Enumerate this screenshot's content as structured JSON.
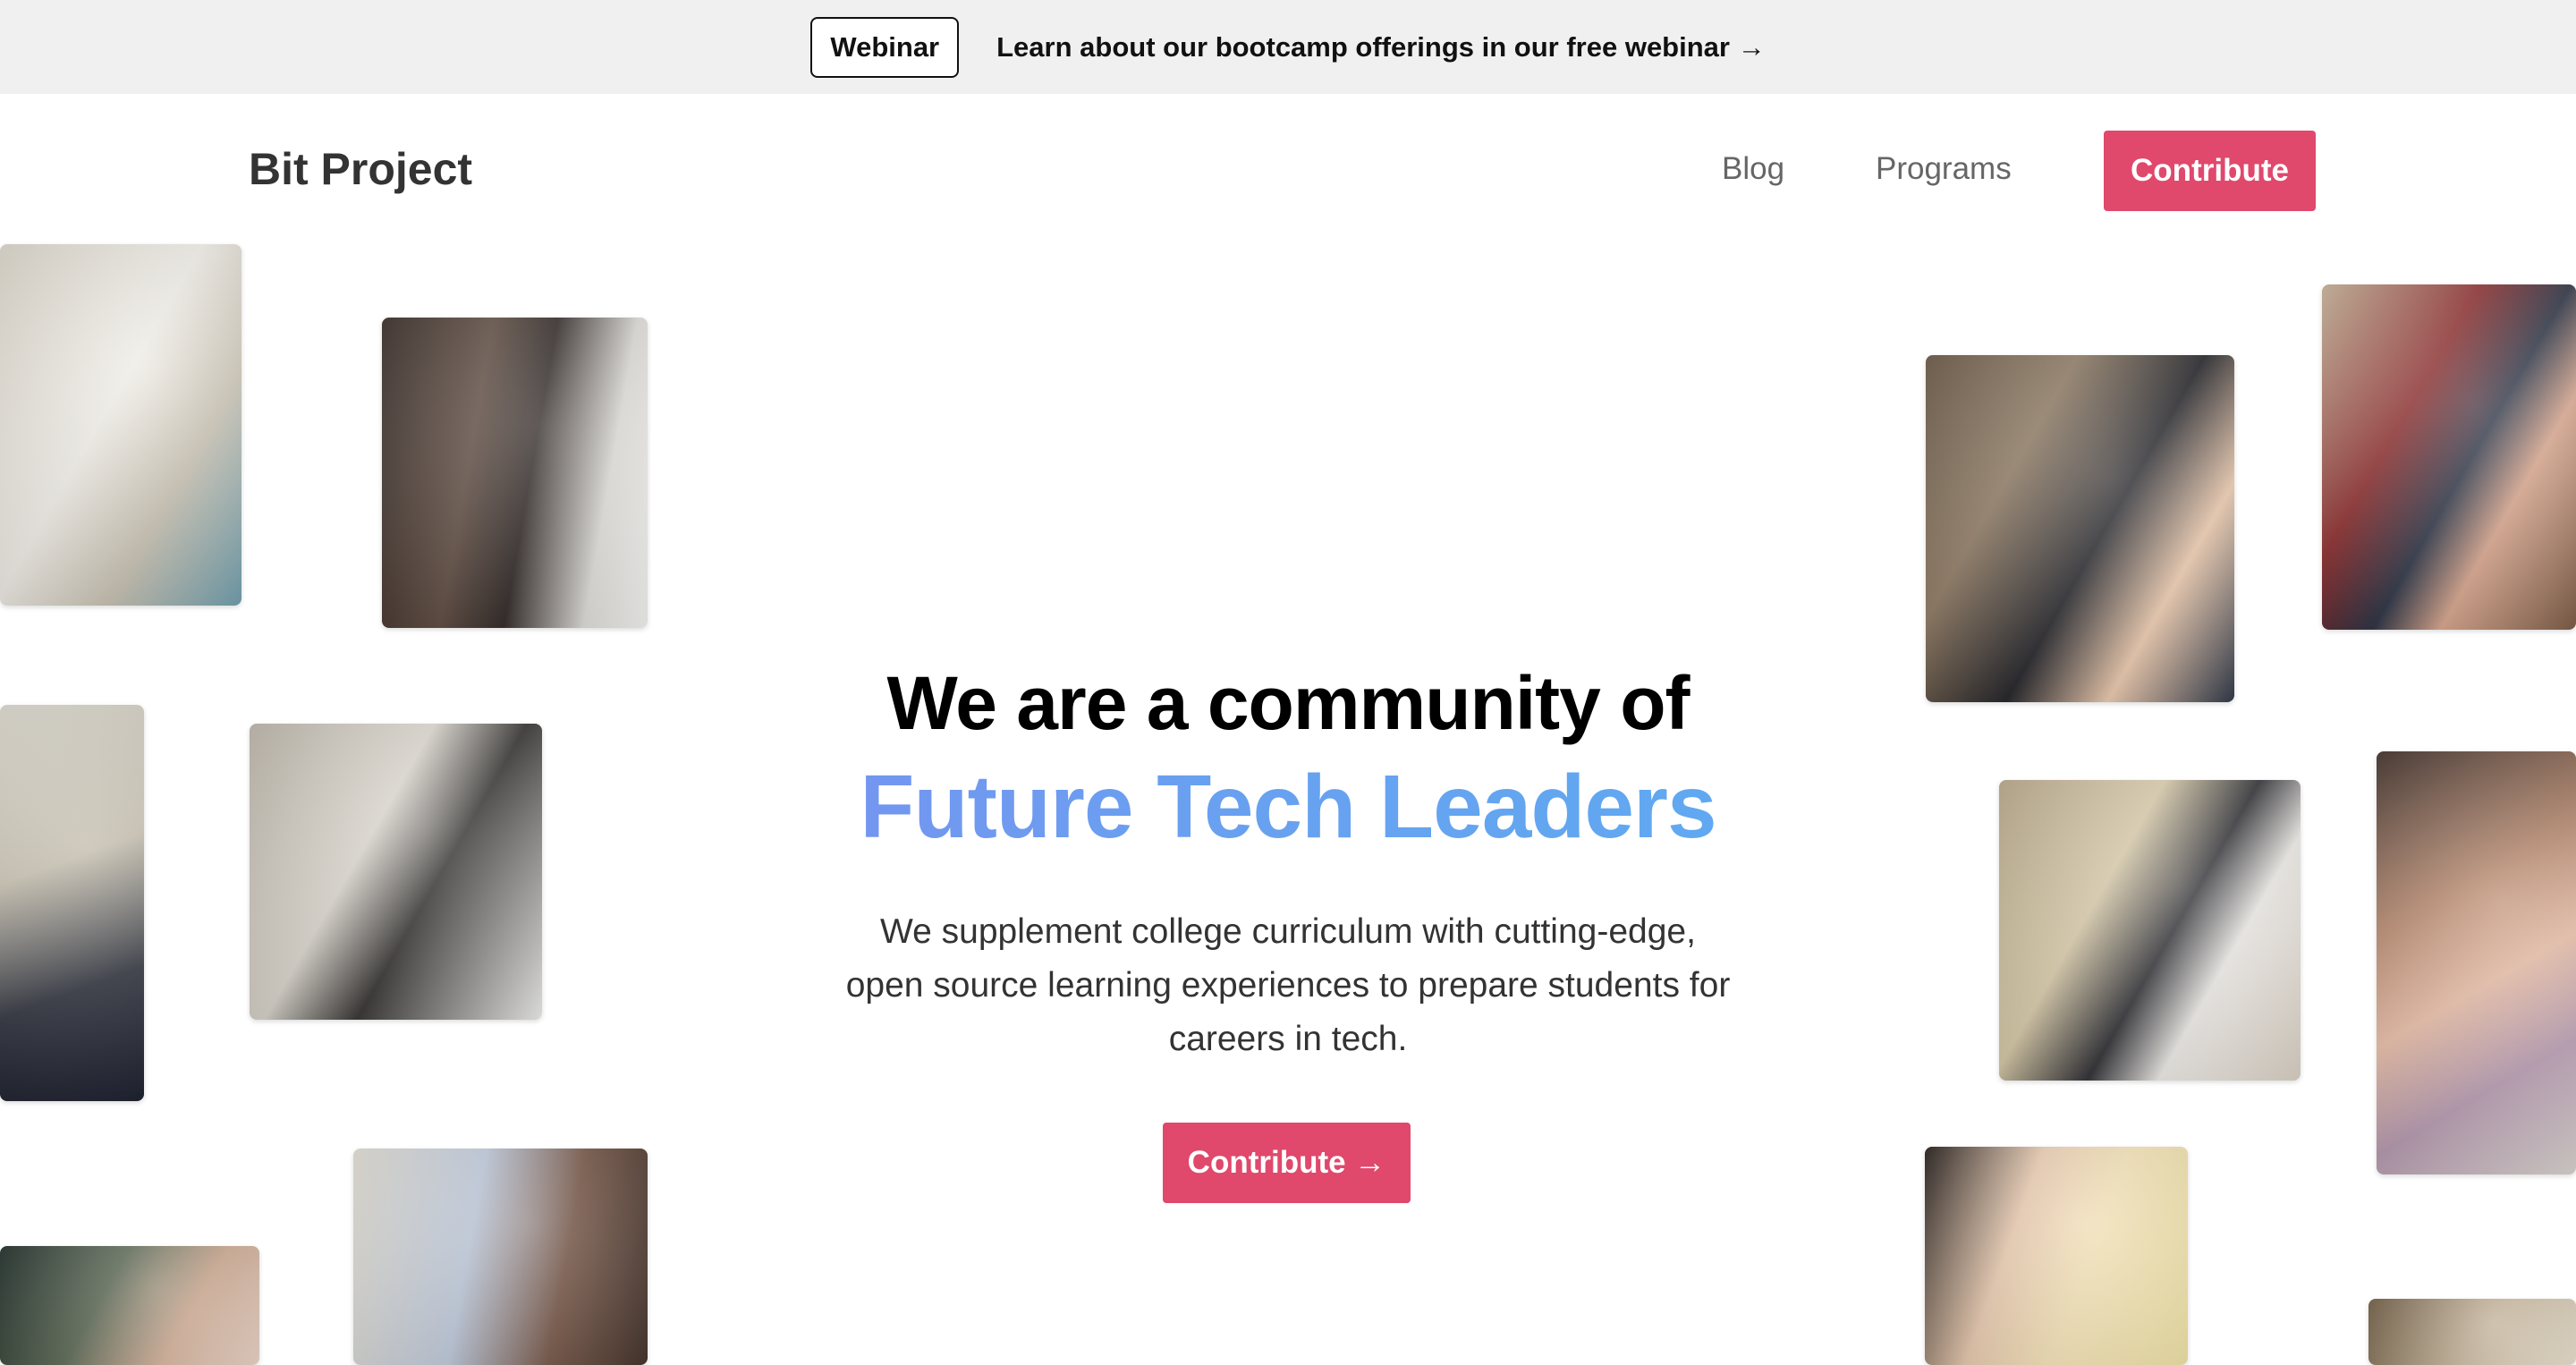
{
  "banner": {
    "badge": "Webinar",
    "link_text": "Learn about our bootcamp offerings in our free webinar →"
  },
  "nav": {
    "brand": "Bit Project",
    "links": [
      "Blog",
      "Programs"
    ],
    "cta": "Contribute"
  },
  "hero": {
    "headline": "We are a community of",
    "headline_gradient": "Future Tech Leaders",
    "subtext": "We supplement college curriculum with cutting-edge, open source learning experiences to prepare students for careers in tech.",
    "cta": "Contribute →"
  },
  "colors": {
    "accent": "#e0486c",
    "banner_bg": "#f0f0f0",
    "gradient_start": "#8e7cf2",
    "gradient_end": "#51b7f2"
  }
}
